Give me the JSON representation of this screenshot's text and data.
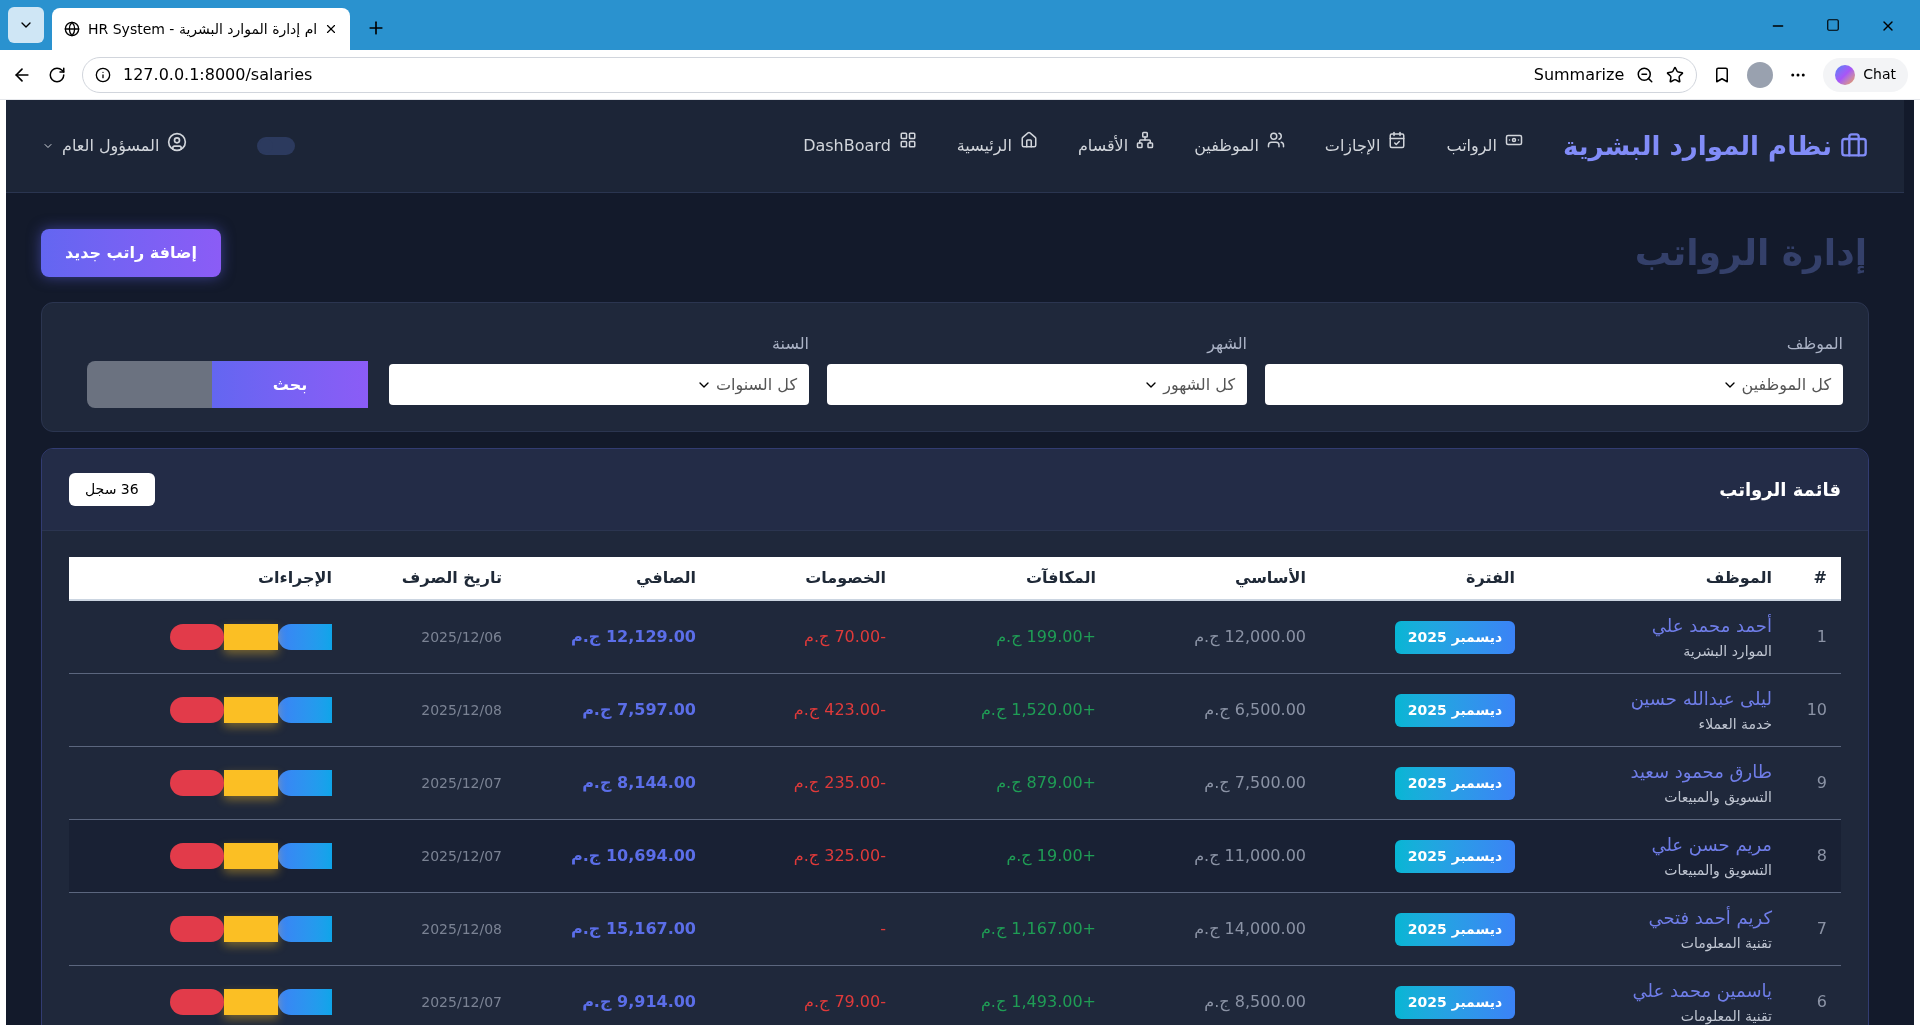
{
  "browser": {
    "tab_title": "HR System - ام إدارة الموارد البشرية",
    "url": "127.0.0.1:8000/salaries",
    "summarize": "Summarize",
    "chat": "Chat"
  },
  "navbar": {
    "brand": "نظام الموارد البشرية",
    "items": [
      {
        "label": "الرواتب",
        "kind": "salaries"
      },
      {
        "label": "الإجازات",
        "kind": "leaves"
      },
      {
        "label": "الموظفين",
        "kind": "employees"
      },
      {
        "label": "الأقسام",
        "kind": "departments"
      },
      {
        "label": "الرئيسية",
        "kind": "home"
      },
      {
        "label": "DashBoard",
        "kind": "dashboard"
      }
    ],
    "theme_toggle": {
      "on": false
    },
    "user": "المسؤول العام"
  },
  "page_title": "إدارة الرواتب",
  "add_button": "إضافة راتب جديد",
  "filters": [
    {
      "label": "الموظف",
      "value": "كل الموظفين"
    },
    {
      "label": "الشهر",
      "value": "كل الشهور"
    },
    {
      "label": "السنة",
      "value": "كل السنوات"
    }
  ],
  "search_button": "بحث",
  "list": {
    "title": "قائمة الرواتب",
    "count": "36 سجل",
    "columns": [
      "#",
      "الموظف",
      "الفترة",
      "الأساسي",
      "المكافآت",
      "الخصومات",
      "الصافي",
      "تاريخ الصرف",
      "الإجراءات"
    ],
    "rows": [
      {
        "id": "1",
        "name": "أحمد محمد علي",
        "department": "الموارد البشرية",
        "period": "ديسمبر 2025",
        "basic": "12,000.00 ج.م",
        "bonus": "+199.00 ج.م",
        "deductions": "-70.00 ج.م",
        "net": "12,129.00 ج.م",
        "date": "2025/12/06"
      },
      {
        "id": "10",
        "name": "ليلى عبدالله حسين",
        "department": "خدمة العملاء",
        "period": "ديسمبر 2025",
        "basic": "6,500.00 ج.م",
        "bonus": "+1,520.00 ج.م",
        "deductions": "-423.00 ج.م",
        "net": "7,597.00 ج.م",
        "date": "2025/12/08"
      },
      {
        "id": "9",
        "name": "طارق محمود سعيد",
        "department": "التسويق والمبيعات",
        "period": "ديسمبر 2025",
        "basic": "7,500.00 ج.م",
        "bonus": "+879.00 ج.م",
        "deductions": "-235.00 ج.م",
        "net": "8,144.00 ج.م",
        "date": "2025/12/07"
      },
      {
        "id": "8",
        "name": "مريم حسن علي",
        "department": "التسويق والمبيعات",
        "period": "ديسمبر 2025",
        "basic": "11,000.00 ج.م",
        "bonus": "+19.00 ج.م",
        "deductions": "-325.00 ج.م",
        "net": "10,694.00 ج.م",
        "date": "2025/12/07"
      },
      {
        "id": "7",
        "name": "كريم أحمد فتحي",
        "department": "تقنية المعلومات",
        "period": "ديسمبر 2025",
        "basic": "14,000.00 ج.م",
        "bonus": "+1,167.00 ج.م",
        "deductions": "-",
        "net": "15,167.00 ج.م",
        "date": "2025/12/08"
      },
      {
        "id": "6",
        "name": "ياسمين محمد علي",
        "department": "تقنية المعلومات",
        "period": "ديسمبر 2025",
        "basic": "8,500.00 ج.م",
        "bonus": "+1,493.00 ج.م",
        "deductions": "-79.00 ج.م",
        "net": "9,914.00 ج.م",
        "date": "2025/12/07"
      }
    ]
  }
}
